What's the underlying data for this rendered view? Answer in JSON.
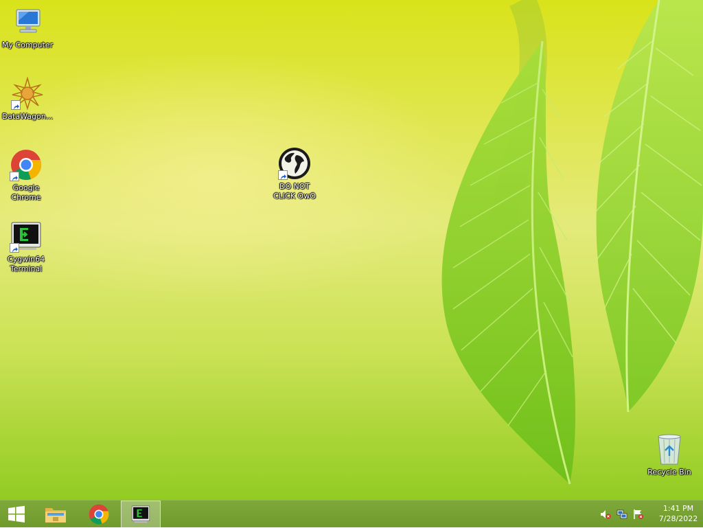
{
  "desktop": {
    "icons": [
      {
        "label": "My Computer"
      },
      {
        "label": "DataWagon..."
      },
      {
        "label": "Google\nChrome"
      },
      {
        "label": "Cygwin64\nTerminal"
      },
      {
        "label": "DO NOT\nCLICK OwO"
      },
      {
        "label": "Recycle Bin"
      }
    ]
  },
  "taskbar": {
    "start_icon": "windows-logo-icon",
    "pinned": [
      "file-explorer-icon",
      "chrome-icon",
      "cygwin-terminal-icon"
    ],
    "tray": [
      "volume-muted-icon",
      "network-icon",
      "action-center-flag-icon"
    ],
    "clock": {
      "time": "1:41 PM",
      "date": "7/28/2022"
    }
  },
  "colors": {
    "taskbar": "#7fa83a",
    "wallpaper_top": "#d9e31a",
    "wallpaper_bottom": "#92cc22"
  }
}
